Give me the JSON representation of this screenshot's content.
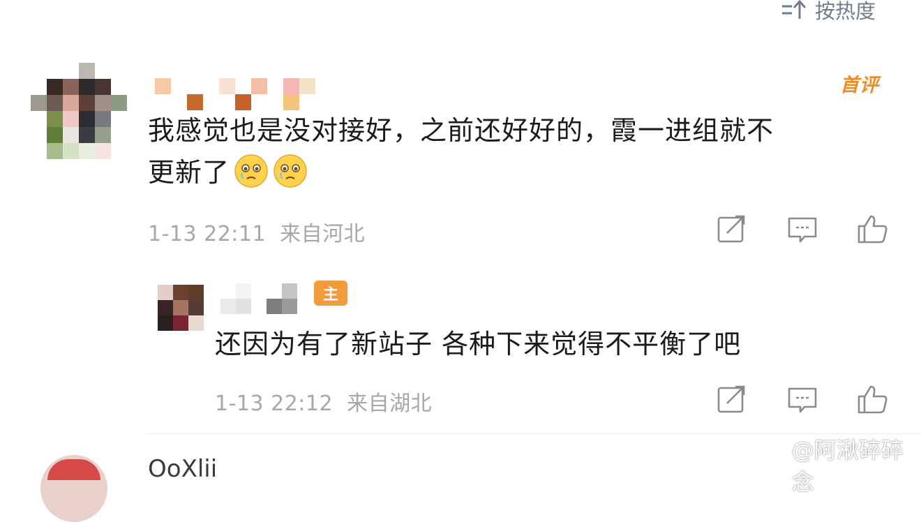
{
  "sort": {
    "label": "按热度",
    "icon": "sort-icon"
  },
  "comments": [
    {
      "first_badge": "首评",
      "text_line1": "我感觉也是没对接好，之前还好好的，霞一进组就不",
      "text_line2": "更新了",
      "emojis": [
        "crying-face-emoji",
        "crying-face-emoji"
      ],
      "time": "1-13 22:11",
      "location": "来自河北",
      "actions": [
        "share-icon",
        "comment-icon",
        "like-icon"
      ]
    },
    {
      "badge": "主",
      "text": "还因为有了新站子 各种下来觉得不平衡了吧",
      "time": "1-13 22:12",
      "location": "来自湖北",
      "actions": [
        "share-icon",
        "comment-icon",
        "like-icon"
      ]
    }
  ],
  "next_comment_name": "OoXlii",
  "watermark": "@阿湫碎碎念",
  "colors": {
    "accent": "#f28a22",
    "meta": "#a7a7a7",
    "sort": "#6f7c8c"
  }
}
